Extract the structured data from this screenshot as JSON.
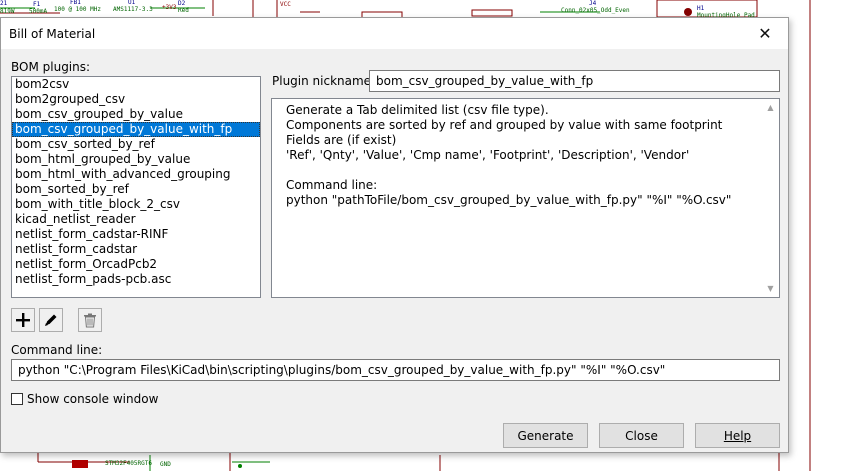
{
  "schematic": {
    "labels": [
      "21",
      "F1",
      "FB1",
      "U1",
      "D2",
      "VCC",
      "J4",
      "H1",
      "819W",
      "500mA",
      "100 @ 100 MHz",
      "AMS1117-3.3",
      "+3V3",
      "Red",
      "Conn_02x05_Odd_Even",
      "MountingHole_Pad",
      "STM32F405RGT6",
      "GND"
    ]
  },
  "dialog": {
    "title": "Bill of Material",
    "close_label": "✕",
    "plugins_label": "BOM plugins:",
    "plugins": [
      "bom2csv",
      "bom2grouped_csv",
      "bom_csv_grouped_by_value",
      "bom_csv_grouped_by_value_with_fp",
      "bom_csv_sorted_by_ref",
      "bom_html_grouped_by_value",
      "bom_html_with_advanced_grouping",
      "bom_sorted_by_ref",
      "bom_with_title_block_2_csv",
      "kicad_netlist_reader",
      "netlist_form_cadstar-RINF",
      "netlist_form_cadstar",
      "netlist_form_OrcadPcb2",
      "netlist_form_pads-pcb.asc"
    ],
    "selected_plugin": "bom_csv_grouped_by_value_with_fp",
    "nickname_label": "Plugin nickname:",
    "nickname_value": "bom_csv_grouped_by_value_with_fp",
    "description": "Generate a Tab delimited list (csv file type).\nComponents are sorted by ref and grouped by value with same footprint\nFields are (if exist)\n'Ref', 'Qnty', 'Value', 'Cmp name', 'Footprint', 'Description', 'Vendor'\n\nCommand line:\npython \"pathToFile/bom_csv_grouped_by_value_with_fp.py\" \"%I\" \"%O.csv\"",
    "command_label": "Command line:",
    "command_value": "python \"C:\\Program Files\\KiCad\\bin\\scripting\\plugins/bom_csv_grouped_by_value_with_fp.py\" \"%I\" \"%O.csv\"",
    "console_label": "Show console window",
    "console_checked": false,
    "buttons": {
      "generate": "Generate",
      "close": "Close",
      "help": "Help"
    },
    "icons": {
      "add": "plus-icon",
      "edit": "pencil-icon",
      "remove": "trash-icon"
    }
  }
}
